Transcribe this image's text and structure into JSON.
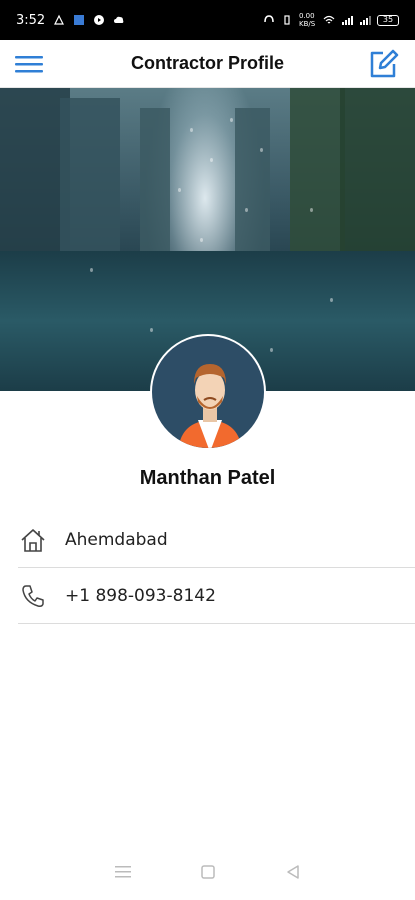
{
  "status_bar": {
    "time": "3:52",
    "network_speed": "0.00 KB/S",
    "battery": "35"
  },
  "app_bar": {
    "title": "Contractor Profile",
    "menu_icon": "hamburger-menu-icon",
    "edit_icon": "edit-icon"
  },
  "profile": {
    "name": "Manthan Patel",
    "location": "Ahemdabad",
    "phone": "+1 898-093-8142"
  },
  "colors": {
    "accent": "#2f7fd6",
    "avatar_bg": "#2d4d66",
    "divider": "#dcdcdc"
  },
  "nav": {
    "recents_icon": "recents-icon",
    "home_icon": "home-square-icon",
    "back_icon": "back-triangle-icon"
  }
}
